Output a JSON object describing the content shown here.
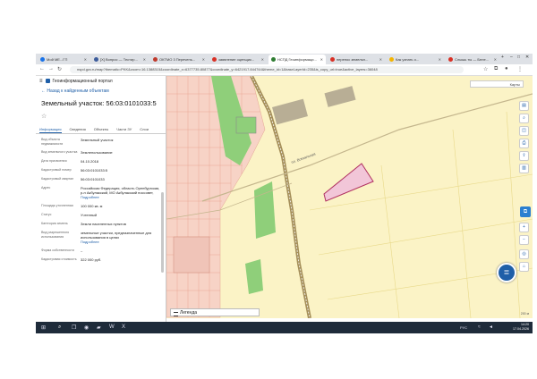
{
  "browser": {
    "tabs": [
      {
        "label": "Мой МЕ...ГП",
        "fav_color": "#1a73e8",
        "active": false
      },
      {
        "label": "[X] Вопрос — Тестир...",
        "fav_color": "#3c5c9c",
        "active": false
      },
      {
        "label": "ОКТМО 3  Перечень...",
        "fav_color": "#c0392b",
        "active": false
      },
      {
        "label": "заявление оценщик...",
        "fav_color": "#d93025",
        "active": false
      },
      {
        "label": "НСПД Геоинформаци...",
        "fav_color": "#2e7d32",
        "active": true
      },
      {
        "label": "перенос земельн...",
        "fav_color": "#d93025",
        "active": false
      },
      {
        "label": "Как узнать о...",
        "fav_color": "#f4b400",
        "active": false
      },
      {
        "label": "Слышь ты — Беле...",
        "fav_color": "#d93025",
        "active": false
      }
    ],
    "new_tab": "+",
    "minimize": "–",
    "maximize": "□",
    "close": "✕",
    "url": "nspd.gov.ru/map?thematic=PKK&zoom=16.1388315&coordinate_x=6377735.80877&coordinate_y=6421917.844744&theme_id=1&baseLayerId=235&is_copy_url=true&active_layers=36048"
  },
  "panel": {
    "portal_title": "Геоинформационный портал",
    "back_label": "Назад к найденным объектам",
    "parcel_title": "Земельный участок: 56:03:0101033:5",
    "tabs": [
      "Информация",
      "Сведения",
      "Объекты",
      "Части ЗУ",
      "Слои"
    ],
    "properties": [
      {
        "key": "Вид объекта недвижимости",
        "value": "Земельный участок",
        "link": ""
      },
      {
        "key": "Вид земельного участка",
        "value": "Землепользование",
        "link": ""
      },
      {
        "key": "Дата присвоения",
        "value": "04.10.2018",
        "link": ""
      },
      {
        "key": "Кадастровый номер",
        "value": "56:03:0101033:5",
        "link": ""
      },
      {
        "key": "Кадастровый квартал",
        "value": "56:03:0101033",
        "link": ""
      },
      {
        "key": "Адрес",
        "value": "Российская Федерация, область Оренбургская, р-н Акбулакский, МО Акбулакский поссовет,",
        "link": "Подробнее"
      },
      {
        "key": "Площадь уточненная",
        "value": "100 000 кв. м",
        "link": ""
      },
      {
        "key": "Статус",
        "value": "Учтенный",
        "link": ""
      },
      {
        "key": "Категория земель",
        "value": "Земли населенных пунктов",
        "link": ""
      },
      {
        "key": "Вид разрешенного использования",
        "value": "земельные участки, предназначенные для использования в целях",
        "link": "Подробнее"
      },
      {
        "key": "Форма собственности",
        "value": "–",
        "link": ""
      },
      {
        "key": "Кадастровая стоимость",
        "value": "322 000 руб.",
        "link": ""
      }
    ]
  },
  "map": {
    "search_label": "Карты",
    "legend_label": "Легенда",
    "street_label": "пл. Вокзальная",
    "scale_label": "200 м",
    "tools": [
      "layers-icon",
      "search-icon",
      "measure-icon",
      "print-icon",
      "share-icon",
      "ruler-icon"
    ],
    "colors": {
      "background": "#fbf3c6",
      "parcel_fill": "#f2c6d8",
      "parcel_stroke": "#b03060",
      "road": "#a58f5a",
      "park": "#8fcf7a",
      "urban": "#f5c6b8"
    }
  },
  "taskbar": {
    "time": "14:20",
    "date": "17.04.2026",
    "lang": "РУС"
  }
}
